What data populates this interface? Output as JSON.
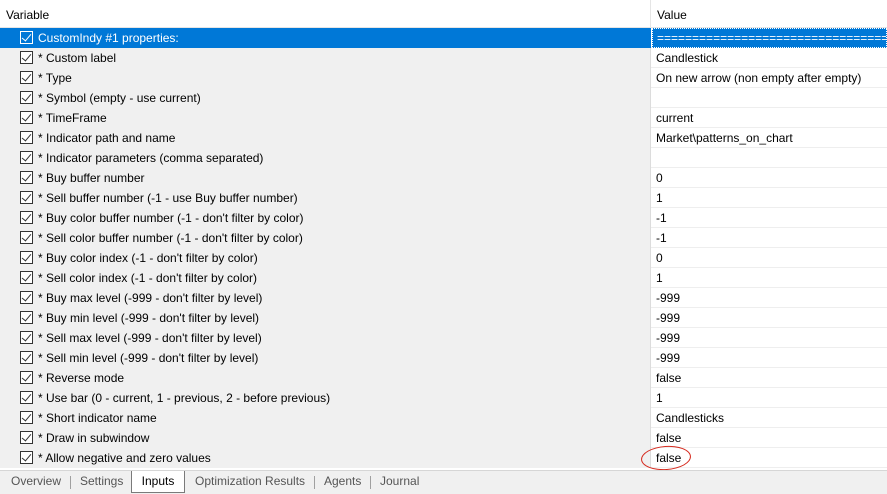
{
  "header": {
    "variable": "Variable",
    "value": "Value"
  },
  "rows": [
    {
      "label": "CustomIndy #1 properties:",
      "value": "==========================================",
      "selected": true
    },
    {
      "label": "* Custom label",
      "value": "Candlestick"
    },
    {
      "label": "* Type",
      "value": "On new arrow (non empty after empty)"
    },
    {
      "label": "* Symbol (empty - use current)",
      "value": ""
    },
    {
      "label": "* TimeFrame",
      "value": "current"
    },
    {
      "label": "* Indicator path and name",
      "value": "Market\\patterns_on_chart"
    },
    {
      "label": "* Indicator parameters (comma separated)",
      "value": ""
    },
    {
      "label": "* Buy buffer number",
      "value": "0"
    },
    {
      "label": "* Sell buffer number (-1 - use Buy buffer number)",
      "value": "1"
    },
    {
      "label": "* Buy color buffer number (-1 - don't filter by color)",
      "value": "-1"
    },
    {
      "label": "* Sell color buffer number (-1 - don't filter by color)",
      "value": "-1"
    },
    {
      "label": "* Buy color index (-1 - don't filter by color)",
      "value": "0"
    },
    {
      "label": "* Sell color index (-1 - don't filter by color)",
      "value": "1"
    },
    {
      "label": "* Buy max level (-999 - don't filter by level)",
      "value": "-999"
    },
    {
      "label": "* Buy min level (-999 - don't filter by level)",
      "value": "-999"
    },
    {
      "label": "* Sell max level (-999 - don't filter by level)",
      "value": "-999"
    },
    {
      "label": "* Sell min level (-999 - don't filter by level)",
      "value": "-999"
    },
    {
      "label": "* Reverse mode",
      "value": "false"
    },
    {
      "label": "* Use bar (0 - current, 1 - previous, 2 - before previous)",
      "value": "1"
    },
    {
      "label": "* Short indicator name",
      "value": "Candlesticks"
    },
    {
      "label": "* Draw in subwindow",
      "value": "false"
    },
    {
      "label": "* Allow negative and zero values",
      "value": "false"
    }
  ],
  "tabs": [
    {
      "label": "Overview"
    },
    {
      "label": "Settings"
    },
    {
      "label": "Inputs",
      "active": true
    },
    {
      "label": "Optimization Results"
    },
    {
      "label": "Agents"
    },
    {
      "label": "Journal"
    }
  ],
  "colors": {
    "selection": "#0078d7",
    "annotation_circle": "#d62a1e"
  }
}
